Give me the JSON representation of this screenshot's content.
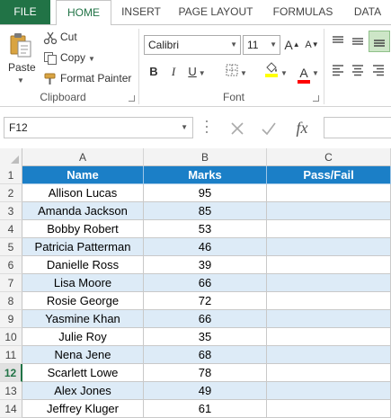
{
  "ribbon_tabs": [
    "FILE",
    "HOME",
    "INSERT",
    "PAGE LAYOUT",
    "FORMULAS",
    "DATA"
  ],
  "active_tab": "HOME",
  "clipboard": {
    "paste_label": "Paste",
    "cut_label": "Cut",
    "copy_label": "Copy",
    "format_painter_label": "Format Painter",
    "group_label": "Clipboard"
  },
  "font": {
    "name": "Calibri",
    "size": "11",
    "bold": "B",
    "italic": "I",
    "underline": "U",
    "grow": "A",
    "shrink": "A",
    "color_letter": "A",
    "group_label": "Font"
  },
  "accent_colors": {
    "excel_green": "#217346",
    "header_blue": "#1b7fc7",
    "band_blue": "#ddebf7",
    "fill_yellow": "#ffff00",
    "font_red": "#ff0000"
  },
  "formula_bar": {
    "name_box": "F12",
    "fx_label": "fx",
    "formula": ""
  },
  "grid": {
    "columns": [
      "A",
      "B",
      "C"
    ],
    "selected_row": "12",
    "rows": [
      {
        "num": "1",
        "name": "Name",
        "marks": "Marks",
        "result": "Pass/Fail"
      },
      {
        "num": "2",
        "name": "Allison Lucas",
        "marks": "95",
        "result": ""
      },
      {
        "num": "3",
        "name": "Amanda Jackson",
        "marks": "85",
        "result": ""
      },
      {
        "num": "4",
        "name": "Bobby Robert",
        "marks": "53",
        "result": ""
      },
      {
        "num": "5",
        "name": "Patricia Patterman",
        "marks": "46",
        "result": ""
      },
      {
        "num": "6",
        "name": "Danielle Ross",
        "marks": "39",
        "result": ""
      },
      {
        "num": "7",
        "name": "Lisa Moore",
        "marks": "66",
        "result": ""
      },
      {
        "num": "8",
        "name": "Rosie George",
        "marks": "72",
        "result": ""
      },
      {
        "num": "9",
        "name": "Yasmine Khan",
        "marks": "66",
        "result": ""
      },
      {
        "num": "10",
        "name": "Julie Roy",
        "marks": "35",
        "result": ""
      },
      {
        "num": "11",
        "name": "Nena Jene",
        "marks": "68",
        "result": ""
      },
      {
        "num": "12",
        "name": "Scarlett Lowe",
        "marks": "78",
        "result": ""
      },
      {
        "num": "13",
        "name": "Alex Jones",
        "marks": "49",
        "result": ""
      },
      {
        "num": "14",
        "name": "Jeffrey Kluger",
        "marks": "61",
        "result": ""
      }
    ]
  }
}
